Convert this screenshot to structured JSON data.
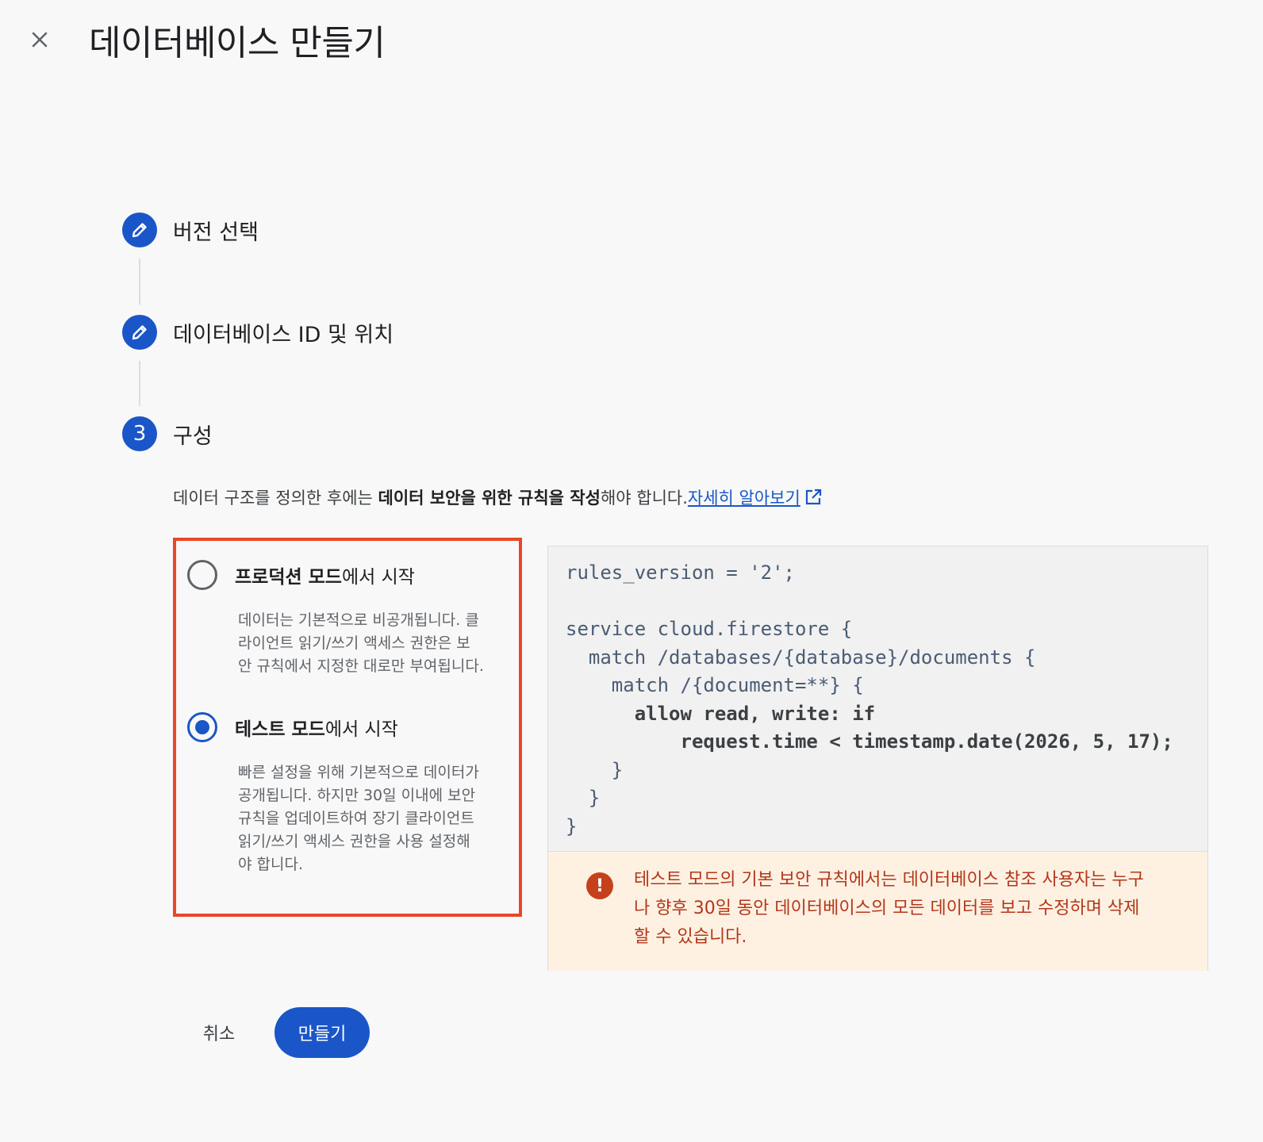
{
  "header": {
    "title": "데이터베이스 만들기",
    "close_icon": "close-icon"
  },
  "stepper": {
    "steps": [
      {
        "label": "버전 선택",
        "state": "completed",
        "icon": "pencil-icon"
      },
      {
        "label": "데이터베이스 ID 및 위치",
        "state": "completed",
        "icon": "pencil-icon"
      },
      {
        "label": "구성",
        "state": "active",
        "number": "3"
      }
    ]
  },
  "description": {
    "prefix": "데이터 구조를 정의한 후에는 ",
    "bold": "데이터 보안을 위한 규칙을 작성",
    "suffix": "해야 합니다.",
    "link": "자세히 알아보기",
    "link_icon": "external-link-icon"
  },
  "options": [
    {
      "title_bold": "프로덕션 모드",
      "title_rest": "에서 시작",
      "selected": false,
      "desc_lines": [
        "데이터는 기본적으로 비공개됩니다. 클",
        "라이언트 읽기/쓰기 액세스 권한은 보",
        "안 규칙에서 지정한 대로만 부여됩니다."
      ]
    },
    {
      "title_bold": "테스트 모드",
      "title_rest": "에서 시작",
      "selected": true,
      "desc_lines": [
        "빠른 설정을 위해 기본적으로 데이터가",
        "공개됩니다. 하지만 30일 이내에 보안",
        "규칙을 업데이트하여 장기 클라이언트",
        "읽기/쓰기 액세스 권한을 사용 설정해",
        "야 합니다."
      ]
    }
  ],
  "code": {
    "lines": [
      "rules_version = '2';",
      "",
      "service cloud.firestore {",
      "  match /databases/{database}/documents {",
      "    match /{document=**} {",
      "      allow read, write: if",
      "          request.time < timestamp.date(2026, 5, 17);",
      "    }",
      "  }",
      "}"
    ]
  },
  "warning": {
    "icon": "alert-icon",
    "icon_glyph": "!",
    "lines": [
      "테스트 모드의 기본 보안 규칙에서는 데이터베이스 참조 사용자는 누구",
      "나 향후 30일 동안 데이터베이스의 모든 데이터를 보고 수정하며 삭제",
      "할 수 있습니다."
    ]
  },
  "footer": {
    "cancel_label": "취소",
    "create_label": "만들기"
  },
  "colors": {
    "accent": "#1a56c8",
    "highlight_border": "#e8472a",
    "warning_text": "#b4361a",
    "warning_bg": "#fef1e2"
  }
}
